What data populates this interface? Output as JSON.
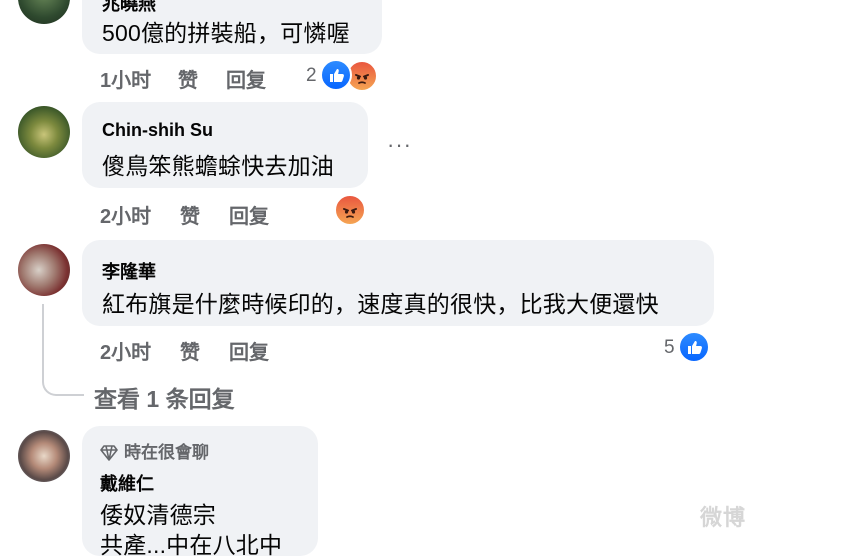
{
  "comments": [
    {
      "author": "兆曉燕",
      "text": "500億的拼裝船，可憐喔",
      "time": "1小时",
      "like_label": "赞",
      "reply_label": "回复",
      "reaction_count": "2",
      "reactions": [
        "like-icon",
        "angry-icon"
      ]
    },
    {
      "author": "Chin-shih Su",
      "text": "傻鳥笨熊蟾蜍快去加油",
      "time": "2小时",
      "like_label": "赞",
      "reply_label": "回复",
      "more": "···",
      "reactions": [
        "angry-icon"
      ]
    },
    {
      "author": "李隆華",
      "text": "紅布旗是什麼時候印的，速度真的很快，比我大便還快",
      "time": "2小时",
      "like_label": "赞",
      "reply_label": "回复",
      "reaction_count": "5",
      "reactions": [
        "like-icon"
      ],
      "view_replies": "查看 1 条回复"
    },
    {
      "badge": "時在很會聊",
      "author": "戴維仁",
      "text": "倭奴清德宗",
      "text2": "共產...中在八北中"
    }
  ],
  "colors": {
    "bubble": "#f0f2f5",
    "secondary_text": "#65676b",
    "like_blue": "#0866ff"
  },
  "watermark": "微博"
}
